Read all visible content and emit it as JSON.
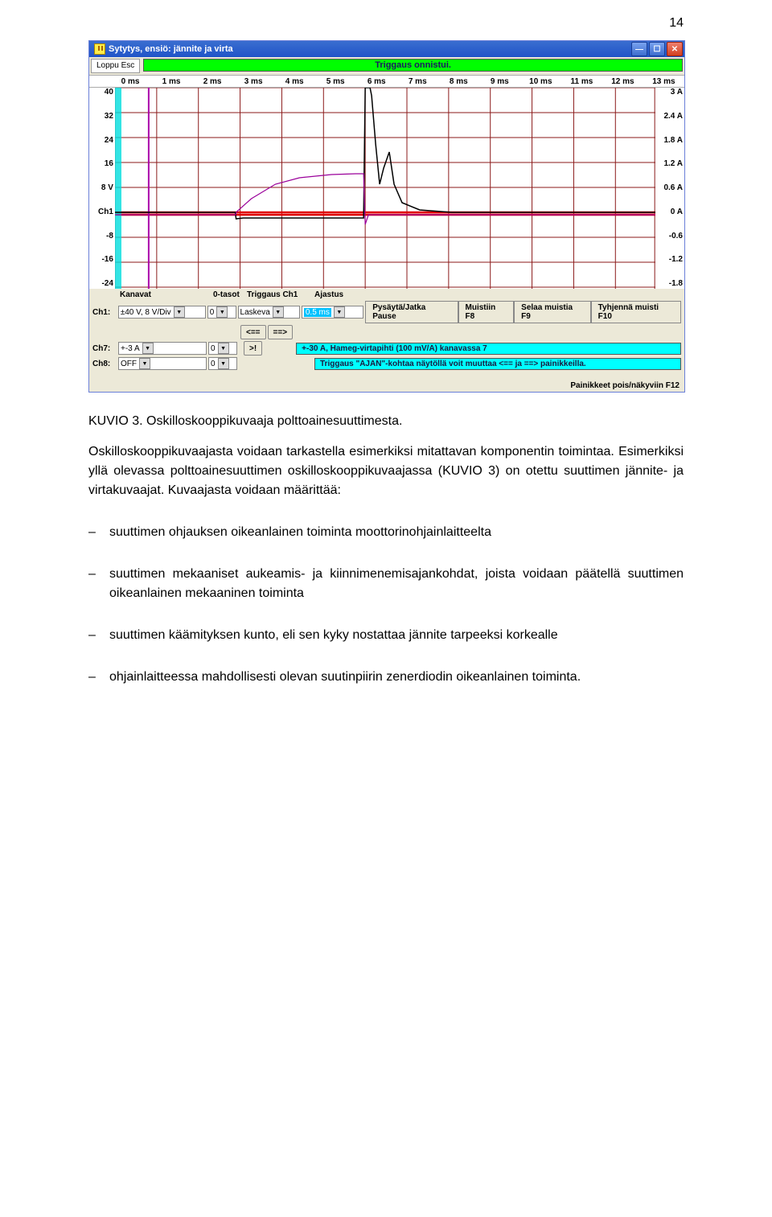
{
  "page_number": "14",
  "scope": {
    "title": "Sytytys, ensiö: jännite ja virta",
    "esc_label": "Loppu  Esc",
    "trigger_banner": "Triggaus onnistui.",
    "xaxis": [
      "0 ms",
      "1 ms",
      "2 ms",
      "3 ms",
      "4 ms",
      "5 ms",
      "6 ms",
      "7 ms",
      "8 ms",
      "9 ms",
      "10 ms",
      "11 ms",
      "12 ms",
      "13 ms"
    ],
    "yleft": [
      "40",
      "32",
      "24",
      "16",
      "8 V",
      "Ch1",
      "-8",
      "-16",
      "-24"
    ],
    "yright": [
      "3 A",
      "2.4 A",
      "1.8 A",
      "1.2 A",
      "0.6 A",
      "0 A",
      "-0.6",
      "-1.2",
      "-1.8"
    ],
    "headers": {
      "kanavat": "Kanavat",
      "otasot": "0-tasot",
      "triggaus": "Triggaus Ch1",
      "ajastus": "Ajastus"
    },
    "rows": {
      "ch1": {
        "label": "Ch1:",
        "range": "±40 V,  8 V/Div",
        "zero": "0",
        "trig": "Laskeva",
        "timebase": "0.5 ms"
      },
      "ch7": {
        "label": "Ch7:",
        "range": "+-3 A",
        "zero": "0"
      },
      "ch8": {
        "label": "Ch8:",
        "range": "OFF",
        "zero": "0"
      }
    },
    "nav_buttons": {
      "left": "<==",
      "right": "==>",
      "excl": ">!"
    },
    "action_buttons": {
      "pause": "Pysäytä/Jatka  Pause",
      "mem": "Muistiin  F8",
      "scroll": "Selaa muistia  F9",
      "clear": "Tyhjennä muisti  F10"
    },
    "cyan_banners": {
      "b1": "+-30 A, Hameg-virtapihti (100 mV/A) kanavassa 7",
      "b2": "Triggaus \"AJAN\"-kohtaa näytöllä voit muuttaa <== ja ==> painikkeilla."
    },
    "status_right": "Painikkeet pois/näkyviin  F12",
    "win_buttons": {
      "min": "—",
      "max": "☐",
      "close": "✕"
    }
  },
  "caption": "KUVIO 3. Oskilloskooppikuvaaja polttoainesuuttimesta.",
  "para": "Oskilloskooppikuvaajasta voidaan tarkastella esimerkiksi mitattavan komponentin toimintaa. Esimerkiksi yllä olevassa polttoainesuuttimen oskilloskooppikuvaajassa (KUVIO 3) on otettu suuttimen jännite- ja virtakuvaajat. Kuvaajasta voidaan määrittää:",
  "bullets": [
    "suuttimen ohjauksen oikeanlainen toiminta moottorinohjainlaitteelta",
    "suuttimen mekaaniset aukeamis- ja kiinnimenemisajankohdat, joista voidaan päätellä suuttimen oikeanlainen mekaaninen toiminta",
    "suuttimen käämityksen kunto, eli sen kyky nostattaa jännite tarpeeksi korkealle",
    "ohjainlaitteessa mahdollisesti olevan suutinpiirin zenerdiodin oikeanlainen toiminta."
  ],
  "chart_data": {
    "type": "line",
    "title": "Sytytys, ensiö: jännite ja virta",
    "xlabel": "ms",
    "x_range_ms": [
      0,
      13
    ],
    "series": [
      {
        "name": "Ch1 jännite (V)",
        "ylabel": "V",
        "ylim": [
          -24,
          40
        ],
        "y_div": 8,
        "points": [
          {
            "x": 0,
            "y": 0
          },
          {
            "x": 2.9,
            "y": 0
          },
          {
            "x": 3.0,
            "y": -2
          },
          {
            "x": 3.2,
            "y": -2
          },
          {
            "x": 6.0,
            "y": -2
          },
          {
            "x": 6.05,
            "y": 40
          },
          {
            "x": 6.1,
            "y": 40
          },
          {
            "x": 6.4,
            "y": 7
          },
          {
            "x": 6.6,
            "y": 12
          },
          {
            "x": 6.8,
            "y": 5
          },
          {
            "x": 7.4,
            "y": 2
          },
          {
            "x": 8.5,
            "y": 0
          },
          {
            "x": 13,
            "y": 0
          }
        ]
      },
      {
        "name": "Ch7 virta (A)",
        "ylabel": "A",
        "ylim": [
          -1.8,
          3
        ],
        "y_div": 0.6,
        "points": [
          {
            "x": 0,
            "y": 0
          },
          {
            "x": 2.9,
            "y": 0
          },
          {
            "x": 3.0,
            "y": 0.1
          },
          {
            "x": 3.4,
            "y": 0.5
          },
          {
            "x": 4.0,
            "y": 0.9
          },
          {
            "x": 4.6,
            "y": 1.0
          },
          {
            "x": 5.6,
            "y": 1.05
          },
          {
            "x": 6.0,
            "y": 1.05
          },
          {
            "x": 6.05,
            "y": -0.3
          },
          {
            "x": 6.15,
            "y": 0
          },
          {
            "x": 6.3,
            "y": 0
          },
          {
            "x": 13,
            "y": 0
          }
        ]
      }
    ]
  }
}
